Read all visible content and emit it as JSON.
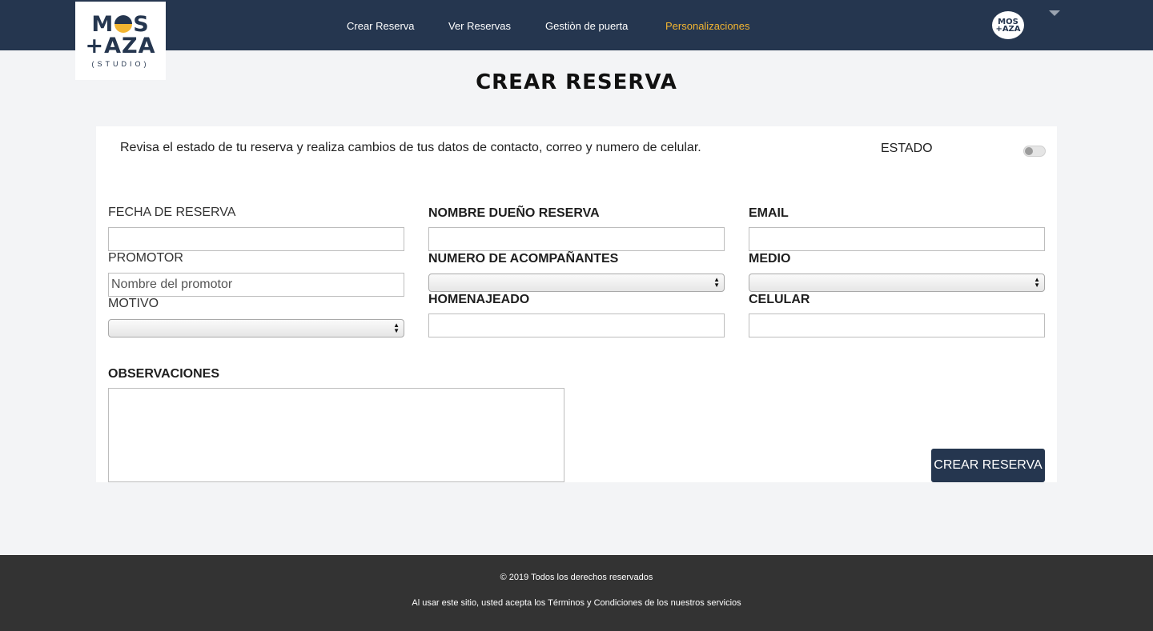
{
  "brand": {
    "logo_line1_a": "M",
    "logo_line1_b": "S",
    "logo_line2": "+AZA",
    "logo_sub": "(STUDIO)",
    "avatar_text": "MOS +AZA"
  },
  "nav": {
    "items": [
      {
        "label": "Crear Reserva"
      },
      {
        "label": "Ver Reservas"
      },
      {
        "label": "Gestiòn de puerta"
      },
      {
        "label": "Personalizaciones"
      }
    ],
    "active_color": "#f2b531"
  },
  "page": {
    "title": "CREAR RESERVA"
  },
  "form": {
    "intro": "Revisa el estado de tu reserva y realiza cambios de tus datos de contacto, correo y numero de celular.",
    "estado_label": "ESTADO",
    "fecha_label": "FECHA DE RESERVA",
    "fecha_value": "",
    "nombre_label": "NOMBRE DUEÑO RESERVA",
    "nombre_value": "",
    "email_label": "EMAIL",
    "email_value": "",
    "promotor_label": "PROMOTOR",
    "promotor_placeholder": "Nombre del promotor",
    "acompanantes_label": "NUMERO DE ACOMPAÑANTES",
    "acompanantes_value": "",
    "medio_label": "MEDIO",
    "medio_value": "",
    "motivo_label": "MOTIVO",
    "motivo_value": "",
    "homenajeado_label": "HOMENAJEADO",
    "homenajeado_value": "",
    "celular_label": "CELULAR",
    "celular_value": "",
    "observaciones_label": "OBSERVACIONES",
    "submit_label": "CREAR RESERVA"
  },
  "footer": {
    "copyright": "© 2019 Todos los derechos reservados",
    "terms": "Al usar este sitio, usted acepta los Términos y Condiciones de los nuestros servicios"
  },
  "colors": {
    "navbar": "#25364f",
    "accent": "#f2b531",
    "footer": "#333333"
  }
}
